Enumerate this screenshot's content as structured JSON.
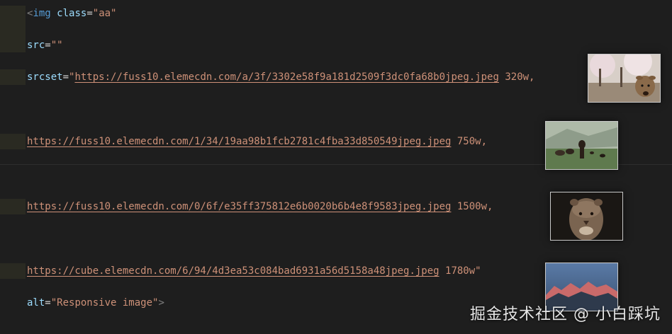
{
  "code": {
    "line1": {
      "open": "<",
      "tag": "img",
      "attr": "class",
      "eq": "=",
      "value": "\"aa\""
    },
    "line2": {
      "attr": "src",
      "eq": "=",
      "value": "\"\""
    },
    "line3": {
      "attr": "srcset",
      "eq": "=",
      "quote": "\"",
      "url": "https://fuss10.elemecdn.com/a/3f/3302e58f9a181d2509f3dc0fa68b0jpeg.jpeg",
      "descriptor": " 320w,"
    },
    "line4": {
      "url": "https://fuss10.elemecdn.com/1/34/19aa98b1fcb2781c4fba33d850549jpeg.jpeg",
      "descriptor": " 750w,"
    },
    "line5": {
      "url": "https://fuss10.elemecdn.com/0/6f/e35ff375812e6b0020b6b4e8f9583jpeg.jpeg",
      "descriptor": " 1500w,"
    },
    "line6": {
      "url": "https://cube.elemecdn.com/6/94/4d3ea53c084bad6931a56d5158a48jpeg.jpeg",
      "descriptor": " 1780w\""
    },
    "line7": {
      "attr": "alt",
      "eq": "=",
      "value": "\"Responsive image\"",
      "close": ">"
    }
  },
  "thumbnails": [
    {
      "name": "deer-under-cherry-blossoms"
    },
    {
      "name": "horses-in-green-valley"
    },
    {
      "name": "lioness-portrait"
    },
    {
      "name": "mountain-at-dusk"
    }
  ],
  "watermark": "掘金技术社区 @ 小白踩坑",
  "colors": {
    "background": "#1e1e1e",
    "tag": "#569cd6",
    "attribute": "#9cdcfe",
    "string": "#ce9178",
    "punctuation": "#808080"
  }
}
